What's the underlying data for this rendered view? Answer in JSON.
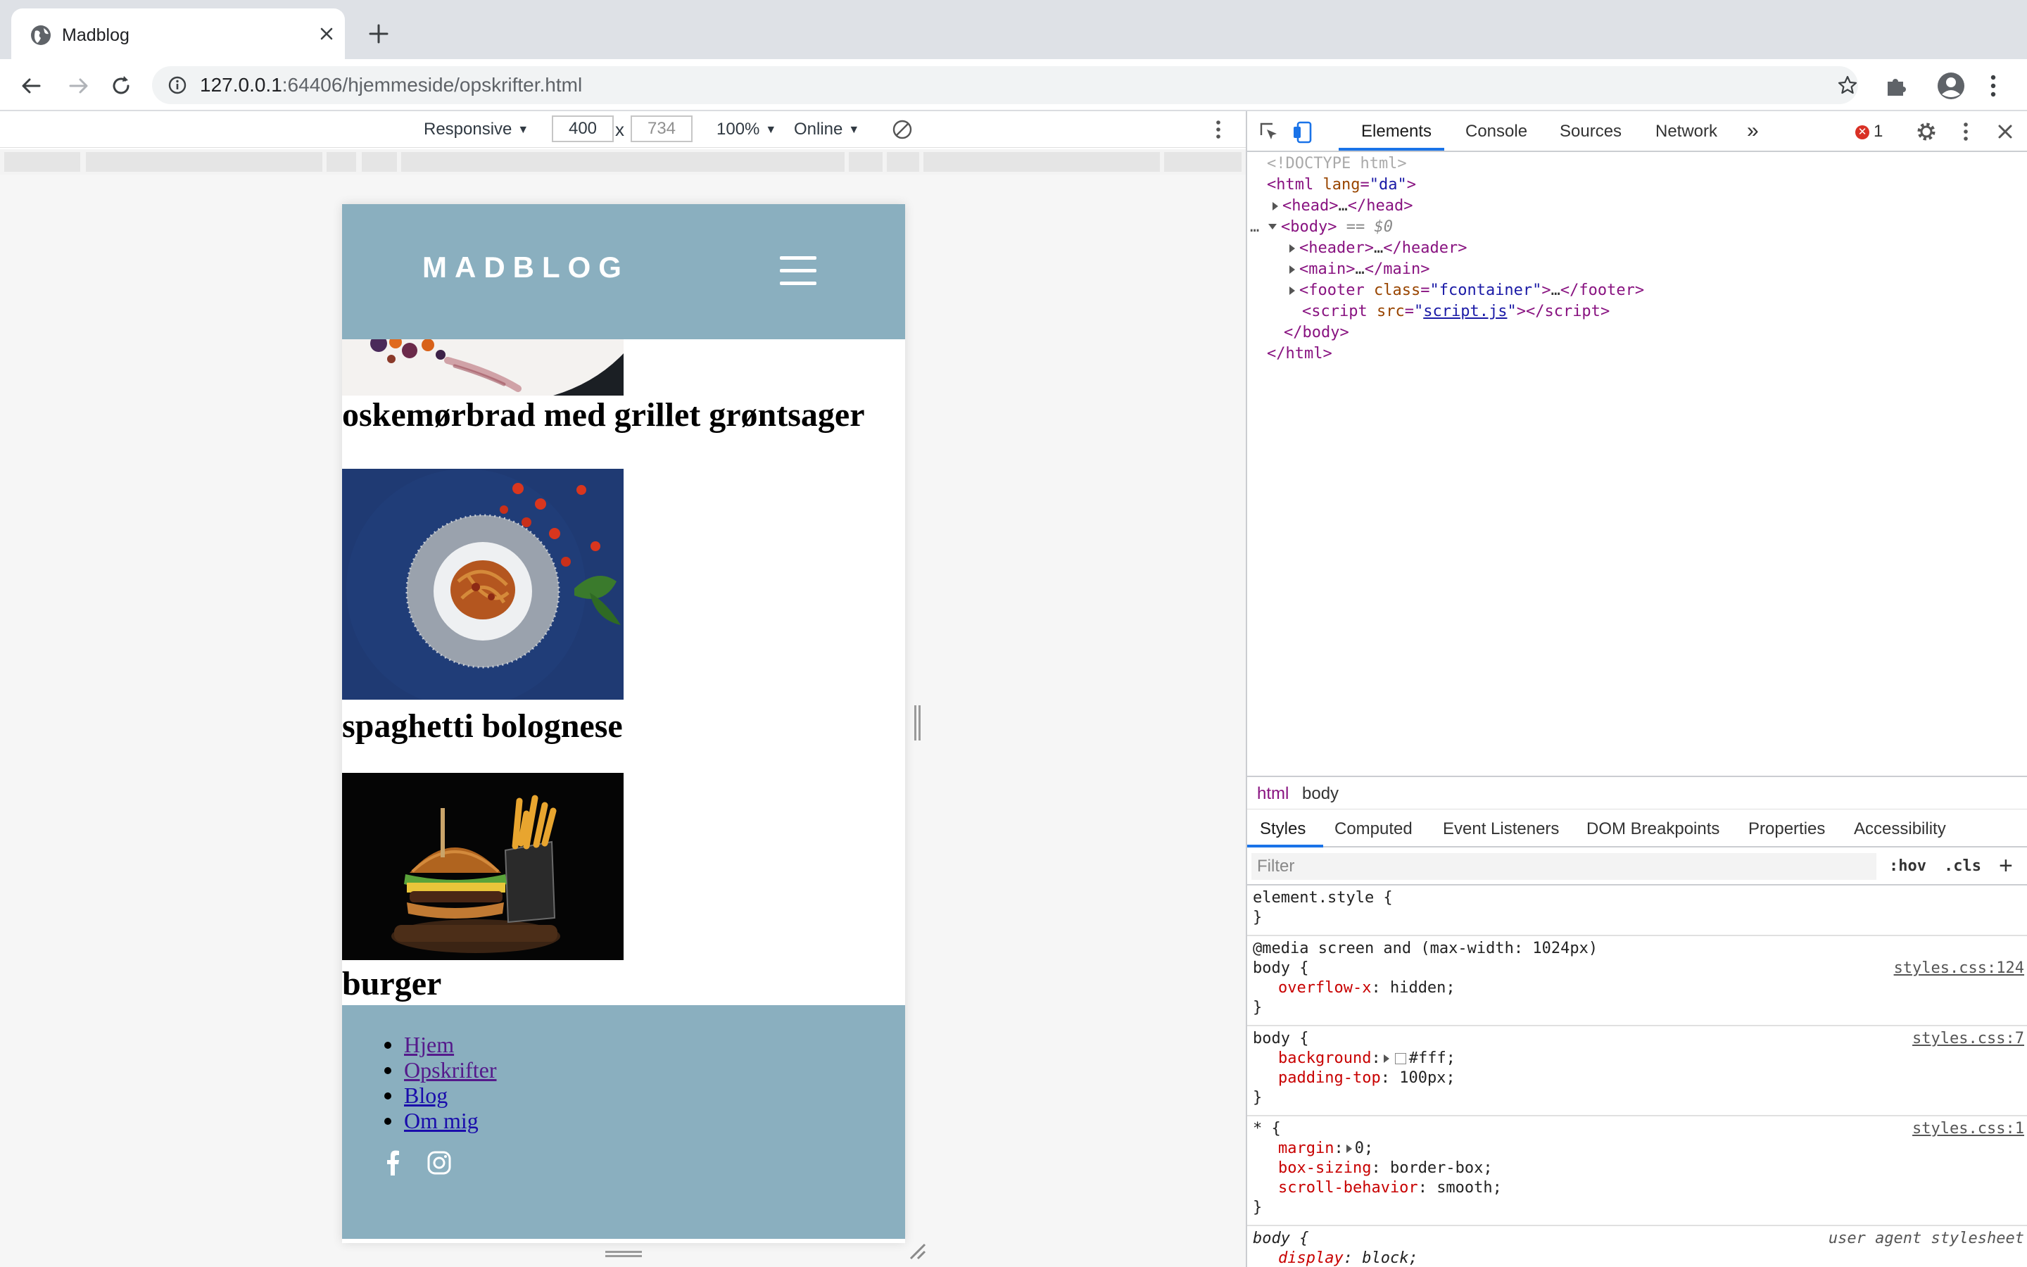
{
  "browser": {
    "tab_title": "Madblog",
    "url_host": "127.0.0.1",
    "url_rest": ":64406/hjemmeside/opskrifter.html"
  },
  "device_toolbar": {
    "mode": "Responsive",
    "width": "400",
    "height": "734",
    "separator": "x",
    "zoom": "100%",
    "network": "Online"
  },
  "site": {
    "logo": "MADBLOG",
    "recipes": [
      {
        "title": "oskemørbrad med grillet grøntsager"
      },
      {
        "title": "spaghetti bolognese"
      },
      {
        "title": "burger"
      }
    ],
    "footer_links": [
      "Hjem",
      "Opskrifter",
      "Blog",
      "Om mig"
    ]
  },
  "devtools": {
    "tabs": [
      "Elements",
      "Console",
      "Sources",
      "Network"
    ],
    "more": "»",
    "error_count": "1",
    "dom": {
      "doctype": "<!DOCTYPE html>",
      "html_open_tag": "html",
      "lang_attr": "lang",
      "lang_val": "da",
      "head": "head",
      "ellipsis": "…",
      "body": "body",
      "selected_marker": "== $0",
      "header": "header",
      "main": "main",
      "footer": "footer",
      "class_attr": "class",
      "class_val": "fcontainer",
      "script": "script",
      "src_attr": "src",
      "src_val": "script.js",
      "body_close": "</body>",
      "html_close": "</html>"
    },
    "breadcrumbs": [
      "html",
      "body"
    ],
    "sub_tabs": [
      "Styles",
      "Computed",
      "Event Listeners",
      "DOM Breakpoints",
      "Properties",
      "Accessibility"
    ],
    "filter_placeholder": "Filter",
    "hov": ":hov",
    "cls": ".cls",
    "plus": "+",
    "rules": {
      "element_style": "element.style {",
      "close": "}",
      "media": "@media screen and (max-width: 1024px)",
      "body_sel": "body {",
      "any_sel": "* {",
      "src1": "styles.css:124",
      "src2": "styles.css:7",
      "src3": "styles.css:1",
      "src4": "user agent stylesheet",
      "overflow_prop": "overflow-x",
      "overflow_val": "hidden;",
      "background_prop": "background",
      "background_val": "#fff;",
      "padding_prop": "padding-top",
      "padding_val": "100px;",
      "margin_prop": "margin",
      "margin_val": "0;",
      "boxsizing_prop": "box-sizing",
      "boxsizing_val": "border-box;",
      "scroll_prop": "scroll-behavior",
      "scroll_val": "smooth;",
      "display_prop": "display",
      "display_val": "block;"
    }
  }
}
